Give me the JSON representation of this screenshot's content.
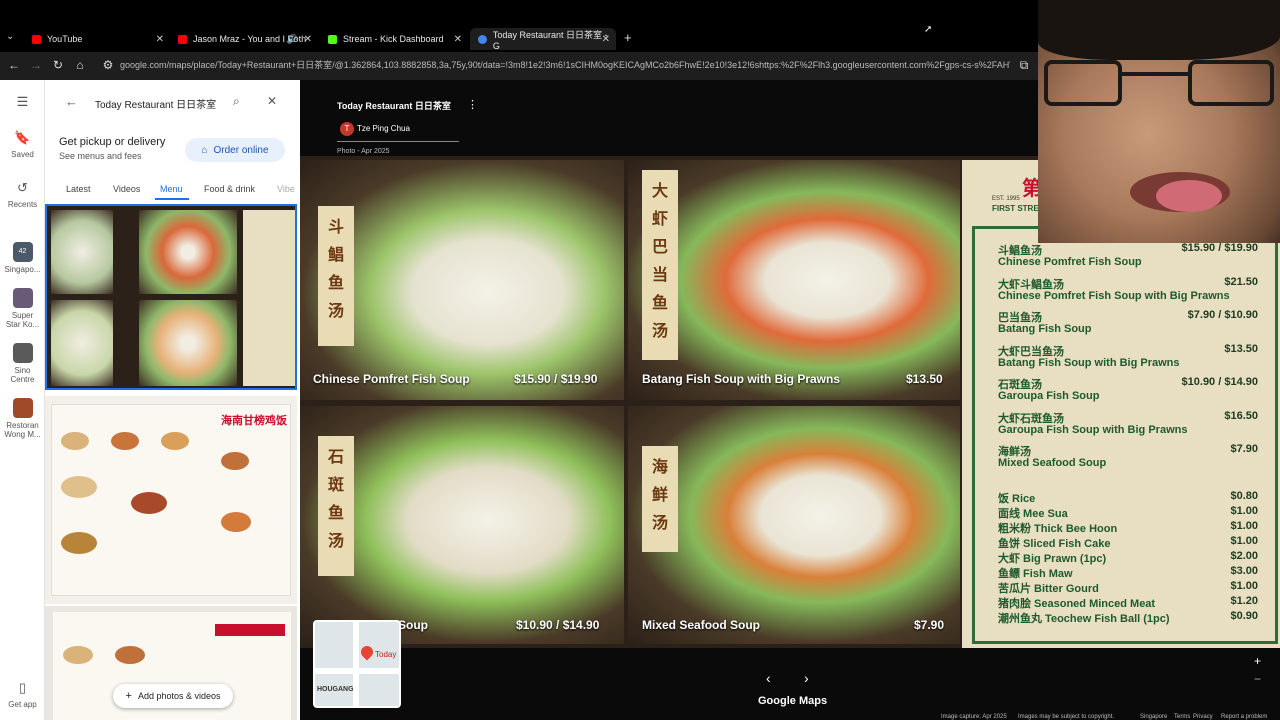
{
  "browser": {
    "tabs": [
      {
        "title": "YouTube",
        "favicon_color": "#ff0000"
      },
      {
        "title": "Jason Mraz - You and I Both",
        "favicon_color": "#ff0000"
      },
      {
        "title": "Stream - Kick Dashboard",
        "favicon_color": "#53fc18"
      },
      {
        "title": "Today Restaurant 日日茶室 - G",
        "favicon_color": "#4285f4"
      }
    ],
    "new_tab": "+",
    "url": "google.com/maps/place/Today+Restaurant+日日茶室/@1.362864,103.8882858,3a,75y,90t/data=!3m8!1e2!3m6!1sCIHM0ogKEICAgMCo2b6FhwE!2e10!3e12!6shttps:%2F%2Flh3.googleusercontent.com%2Fgps-cs-s%2FAHVAwer6"
  },
  "rail": {
    "items": [
      {
        "label": "Saved",
        "icon": "bookmark-icon"
      },
      {
        "label": "Recents",
        "icon": "history-icon"
      },
      {
        "label": "Singapo...",
        "badge": "42"
      },
      {
        "label": "Super Star Ko..."
      },
      {
        "label": "Sino Centre"
      },
      {
        "label": "Restoran Wong M..."
      },
      {
        "label": "Get app",
        "icon": "phone-icon"
      }
    ]
  },
  "panel": {
    "search_value": "Today Restaurant 日日茶室",
    "pickup_title": "Get pickup or delivery",
    "pickup_sub": "See menus and fees",
    "order_label": "Order online",
    "tabs": [
      "Latest",
      "Videos",
      "Menu",
      "Food & drink",
      "Vibe"
    ],
    "active_tab": "Menu",
    "add_photos_label": "Add photos & videos",
    "photo2_title": "海南甘榜鸡饭"
  },
  "viewer": {
    "place_title": "Today Restaurant 日日茶室",
    "author_initial": "T",
    "author": "Tze Ping Chua",
    "photo_date": "Photo - Apr 2025",
    "cards": [
      {
        "cn": [
          "斗",
          "鲳",
          "鱼",
          "汤"
        ],
        "name": "Chinese Pomfret Fish Soup",
        "price": "$15.90 / $19.90"
      },
      {
        "cn": [
          "大",
          "虾",
          "巴",
          "当",
          "鱼",
          "汤"
        ],
        "name": "Batang Fish Soup with Big Prawns",
        "price": "$13.50"
      },
      {
        "cn": [
          "石",
          "斑",
          "鱼",
          "汤"
        ],
        "name": "Soup",
        "price": "$10.90 / $14.90"
      },
      {
        "cn": [
          "海",
          "鲜",
          "汤"
        ],
        "name": "Mixed Seafood Soup",
        "price": "$7.90"
      }
    ],
    "board_header": "第一",
    "board_sub": "FIRST STREET TE",
    "board_est": "EST. 1995",
    "price_list": [
      {
        "cn": "斗鲳鱼汤",
        "en": "Chinese Pomfret Fish Soup",
        "price": "$15.90 / $19.90"
      },
      {
        "cn": "大虾斗鲳鱼汤",
        "en": "Chinese Pomfret Fish Soup with Big Prawns",
        "price": "$21.50"
      },
      {
        "cn": "巴当鱼汤",
        "en": "Batang Fish Soup",
        "price": "$7.90 / $10.90"
      },
      {
        "cn": "大虾巴当鱼汤",
        "en": "Batang Fish Soup with Big Prawns",
        "price": "$13.50"
      },
      {
        "cn": "石斑鱼汤",
        "en": "Garoupa Fish Soup",
        "price": "$10.90 / $14.90"
      },
      {
        "cn": "大虾石斑鱼汤",
        "en": "Garoupa Fish Soup with Big Prawns",
        "price": "$16.50"
      },
      {
        "cn": "海鲜汤",
        "en": "Mixed Seafood Soup",
        "price": "$7.90"
      }
    ],
    "sides": [
      {
        "text": "饭 Rice",
        "price": "$0.80"
      },
      {
        "text": "面线 Mee Sua",
        "price": "$1.00"
      },
      {
        "text": "粗米粉 Thick Bee Hoon",
        "price": "$1.00"
      },
      {
        "text": "鱼饼 Sliced Fish Cake",
        "price": "$1.00"
      },
      {
        "text": "大虾 Big Prawn (1pc)",
        "price": "$2.00"
      },
      {
        "text": "鱼鳔 Fish Maw",
        "price": "$3.00"
      },
      {
        "text": "苦瓜片 Bitter Gourd",
        "price": "$1.00"
      },
      {
        "text": "猪肉脍 Seasoned Minced Meat",
        "price": "$1.20"
      },
      {
        "text": "潮州鱼丸 Teochew Fish Ball (1pc)",
        "price": "$0.90"
      }
    ],
    "minimap_label": "Today",
    "minimap_area": "HOUGANG",
    "brand": "Google Maps",
    "footer": [
      "Image capture: Apr 2025",
      "Images may be subject to copyright.",
      "Singapore",
      "Terms",
      "Privacy",
      "Report a problem"
    ],
    "zoom_in": "+",
    "zoom_out": "−"
  },
  "colors": {
    "accent": "#1a73e8",
    "board_green": "#1e5a2e",
    "board_bg": "#e8dfc2"
  }
}
